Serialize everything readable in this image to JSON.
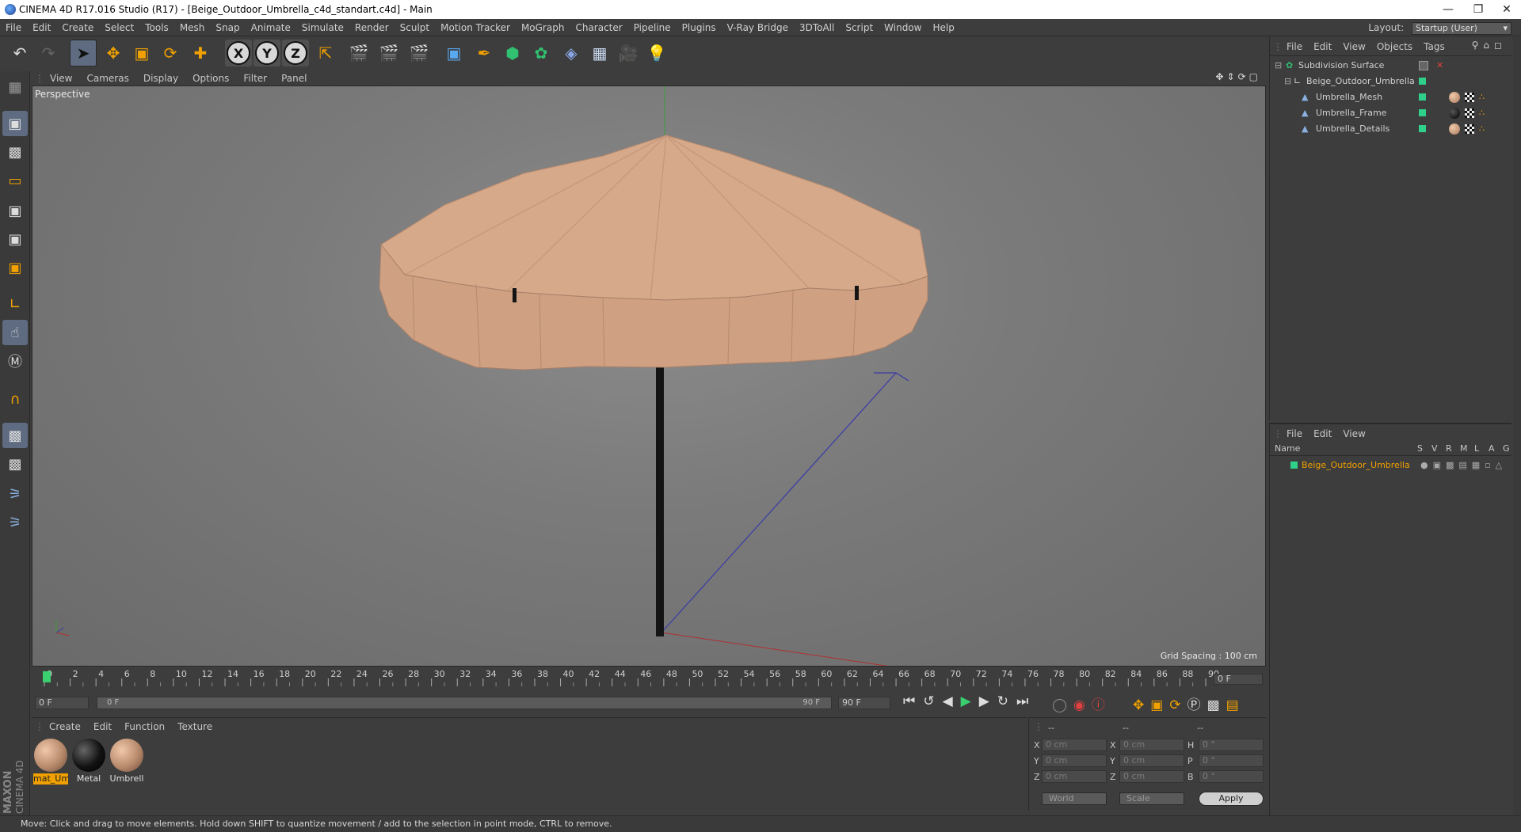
{
  "window": {
    "title": "CINEMA 4D R17.016 Studio (R17) - [Beige_Outdoor_Umbrella_c4d_standart.c4d] - Main"
  },
  "menubar": {
    "items": [
      "File",
      "Edit",
      "Create",
      "Select",
      "Tools",
      "Mesh",
      "Snap",
      "Animate",
      "Simulate",
      "Render",
      "Sculpt",
      "Motion Tracker",
      "MoGraph",
      "Character",
      "Pipeline",
      "Plugins",
      "V-Ray Bridge",
      "3DToAll",
      "Script",
      "Window",
      "Help"
    ],
    "layout_label": "Layout:",
    "layout_value": "Startup (User)"
  },
  "toolbar": {
    "axis_x": "X",
    "axis_y": "Y",
    "axis_z": "Z"
  },
  "viewport": {
    "menu": [
      "View",
      "Cameras",
      "Display",
      "Options",
      "Filter",
      "Panel"
    ],
    "view_name": "Perspective",
    "grid_spacing": "Grid Spacing : 100 cm"
  },
  "timeline": {
    "ticks": [
      "0",
      "2",
      "4",
      "6",
      "8",
      "10",
      "12",
      "14",
      "16",
      "18",
      "20",
      "22",
      "24",
      "26",
      "28",
      "30",
      "32",
      "34",
      "36",
      "38",
      "40",
      "42",
      "44",
      "46",
      "48",
      "50",
      "52",
      "54",
      "56",
      "58",
      "60",
      "62",
      "64",
      "66",
      "68",
      "70",
      "72",
      "74",
      "76",
      "78",
      "80",
      "82",
      "84",
      "86",
      "88",
      "90"
    ],
    "current_frame": "0 F",
    "start_field": "0 F",
    "range_start": "0 F",
    "range_end": "90 F",
    "end_field": "90 F"
  },
  "material_panel": {
    "menu": [
      "Create",
      "Edit",
      "Function",
      "Texture"
    ],
    "materials": [
      {
        "name": "mat_Um",
        "color": "#c9a184",
        "selected": true
      },
      {
        "name": "Metal",
        "color": "#111111",
        "selected": false
      },
      {
        "name": "Umbrell",
        "color": "#c9a184",
        "selected": false
      }
    ]
  },
  "coord_panel": {
    "headers": [
      "--",
      "--",
      "--"
    ],
    "rows": [
      {
        "axis": "X",
        "pos": "0 cm",
        "axis2": "X",
        "size": "0 cm",
        "rot_label": "H",
        "rot": "0 °"
      },
      {
        "axis": "Y",
        "pos": "0 cm",
        "axis2": "Y",
        "size": "0 cm",
        "rot_label": "P",
        "rot": "0 °"
      },
      {
        "axis": "Z",
        "pos": "0 cm",
        "axis2": "Z",
        "size": "0 cm",
        "rot_label": "B",
        "rot": "0 °"
      }
    ],
    "space": "World",
    "mode": "Scale",
    "apply": "Apply"
  },
  "object_manager": {
    "menu": [
      "File",
      "Edit",
      "View",
      "Objects",
      "Tags"
    ],
    "objects": [
      {
        "name": "Subdivision Surface",
        "level": 0
      },
      {
        "name": "Beige_Outdoor_Umbrella",
        "level": 1
      },
      {
        "name": "Umbrella_Mesh",
        "level": 2
      },
      {
        "name": "Umbrella_Frame",
        "level": 2
      },
      {
        "name": "Umbrella_Details",
        "level": 2
      }
    ]
  },
  "attribute_manager": {
    "menu": [
      "File",
      "Edit",
      "View"
    ],
    "columns": [
      "Name",
      "S",
      "V",
      "R",
      "M",
      "L",
      "A",
      "G"
    ],
    "layer_name": "Beige_Outdoor_Umbrella"
  },
  "statusbar": {
    "text": "Move: Click and drag to move elements. Hold down SHIFT to quantize movement / add to the selection in point mode, CTRL to remove."
  },
  "branding": {
    "maxon": "MAXON",
    "cinema": "CINEMA 4D"
  },
  "colors": {
    "accent_orange": "#f0a000",
    "umbrella_fabric": "#d6a98a",
    "layer_green": "#2fd08a"
  }
}
